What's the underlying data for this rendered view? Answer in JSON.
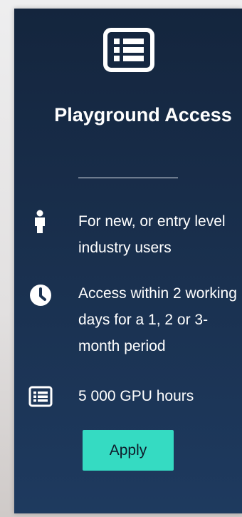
{
  "card": {
    "title": "Playground Access",
    "icons": {
      "header": "list-icon",
      "person": "person-icon",
      "clock": "clock-icon",
      "list": "list-icon"
    },
    "features": [
      {
        "icon": "person-icon",
        "text": "For new, or entry level industry users"
      },
      {
        "icon": "clock-icon",
        "text": "Access within 2 working days for a 1, 2 or 3-month period"
      },
      {
        "icon": "list-icon",
        "text": "5 000 GPU hours"
      }
    ],
    "apply_label": "Apply"
  },
  "colors": {
    "card_top": "#14253d",
    "card_bottom": "#1e3a5f",
    "text": "#ffffff",
    "button_bg": "#35dbc2",
    "button_text": "#0e1b2a",
    "page_bg": "#e6e4e4"
  }
}
